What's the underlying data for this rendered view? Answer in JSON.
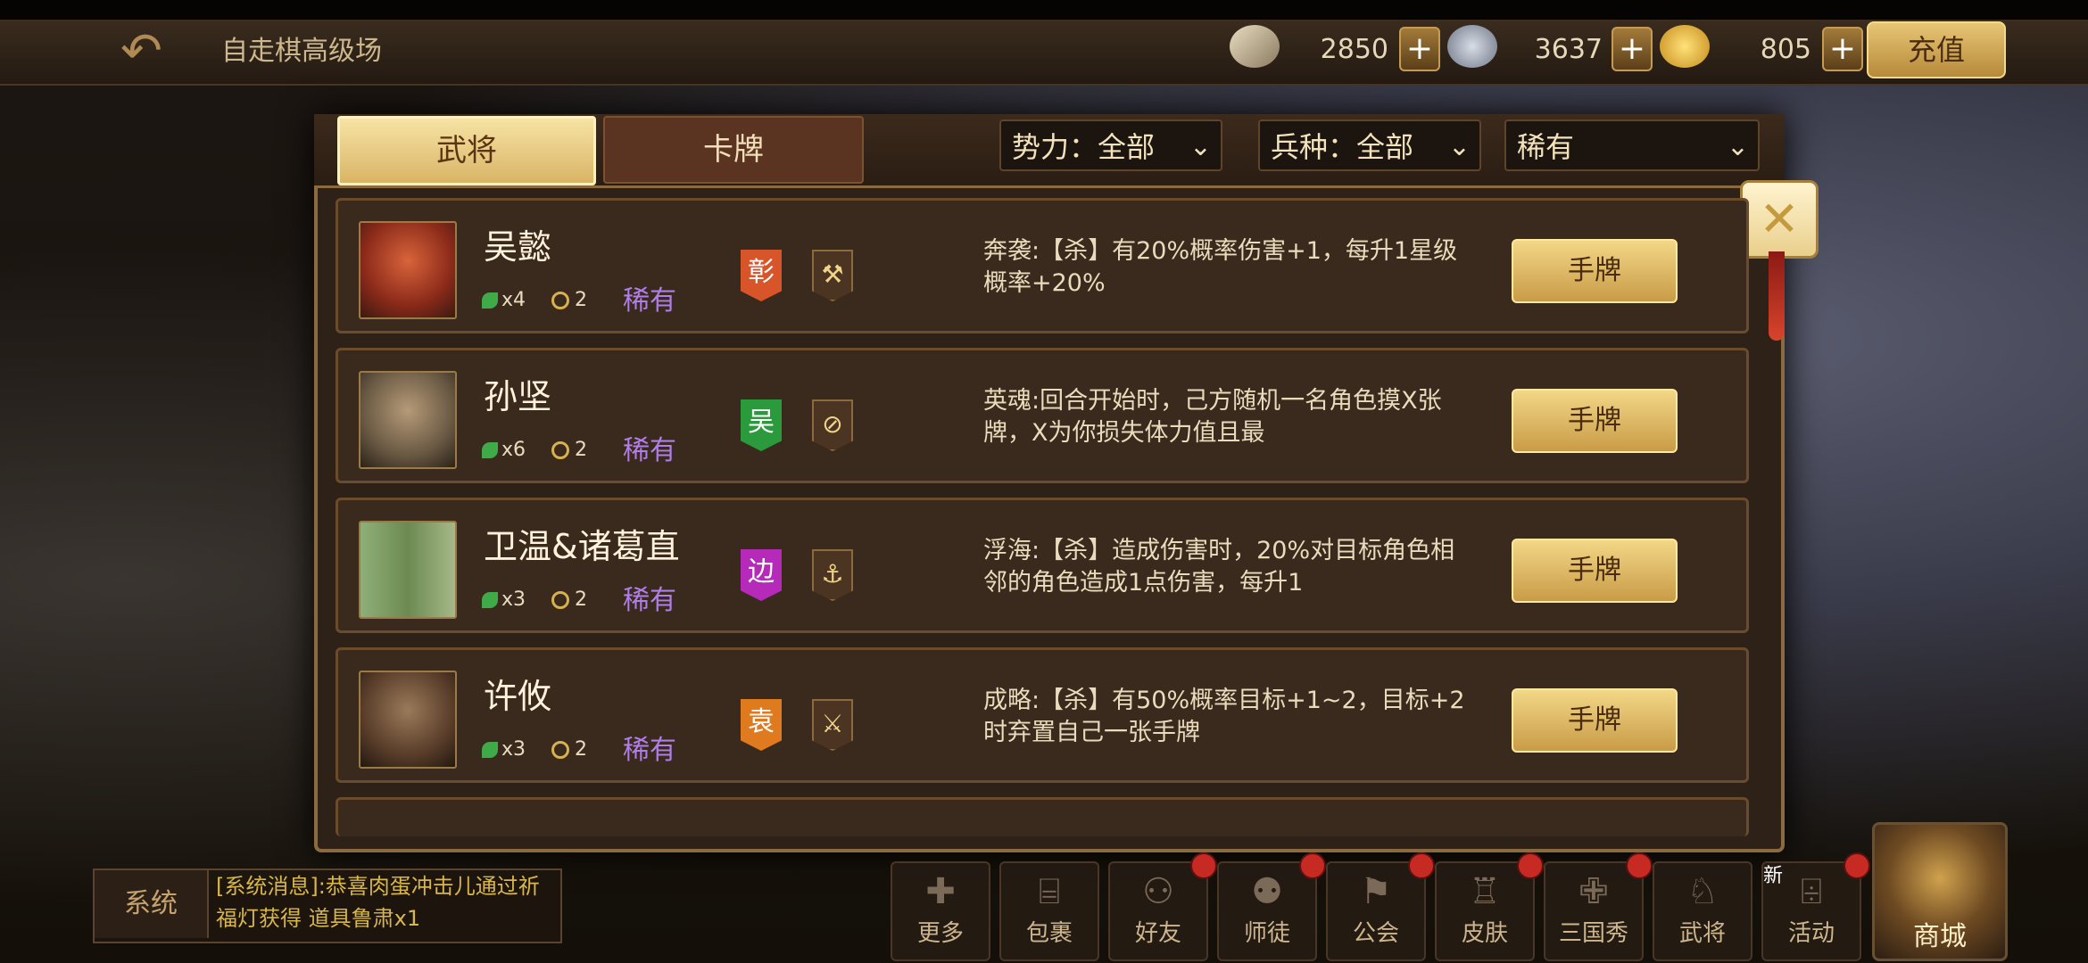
{
  "topbar": {
    "title": "自走棋高级场",
    "currencies": [
      {
        "icon": "scroll-icon",
        "value": "2850"
      },
      {
        "icon": "silver-ingot-icon",
        "value": "3637"
      },
      {
        "icon": "gold-ingot-icon",
        "value": "805"
      }
    ],
    "plus": "+",
    "recharge_label": "充值"
  },
  "panel": {
    "tabs": [
      "武将",
      "卡牌"
    ],
    "active_tab": "武将",
    "filters": {
      "faction": "势力：全部",
      "troop": "兵种：全部",
      "rarity": "稀有"
    },
    "close": "✕",
    "rows": [
      {
        "name": "吴懿",
        "stars": "x4",
        "cost": "2",
        "rarity": "稀有",
        "faction": "彰",
        "faction_color": "#d8552a",
        "unit_icon": "axe-icon",
        "unit_glyph": "⚒",
        "desc": "奔袭:【杀】有20%概率伤害+1，每升1星级概率+20%",
        "button": "手牌",
        "avatar_color": "#8b2a1a"
      },
      {
        "name": "孙坚",
        "stars": "x6",
        "cost": "2",
        "rarity": "稀有",
        "faction": "吴",
        "faction_color": "#2a9a3c",
        "unit_icon": "shield-icon",
        "unit_glyph": "⊘",
        "desc": "英魂:回合开始时，己方随机一名角色摸X张牌，X为你损失体力值且最",
        "button": "手牌",
        "avatar_color": "#6a5a44"
      },
      {
        "name": "卫温&诸葛直",
        "stars": "x3",
        "cost": "2",
        "rarity": "稀有",
        "faction": "边",
        "faction_color": "#b52ab8",
        "unit_icon": "anchor-icon",
        "unit_glyph": "⚓",
        "desc": "浮海:【杀】造成伤害时，20%对目标角色相邻的角色造成1点伤害，每升1",
        "button": "手牌",
        "avatar_color": "#6c8a52"
      },
      {
        "name": "许攸",
        "stars": "x3",
        "cost": "2",
        "rarity": "稀有",
        "faction": "袁",
        "faction_color": "#e07a1e",
        "unit_icon": "sword-icon",
        "unit_glyph": "⚔",
        "desc": "成略:【杀】有50%概率目标+1~2，目标+2时弃置自己一张手牌",
        "button": "手牌",
        "avatar_color": "#5a3e2a"
      }
    ]
  },
  "chat": {
    "tab": "系统",
    "message": "[系统消息]:恭喜肉蛋冲击儿通过祈福灯获得 道具鲁肃x1"
  },
  "nav": {
    "items": [
      {
        "label": "更多",
        "icon": "plus-icon",
        "glyph": "✚",
        "badge": false
      },
      {
        "label": "包裹",
        "icon": "bag-icon",
        "glyph": "⌸",
        "badge": false
      },
      {
        "label": "好友",
        "icon": "friends-icon",
        "glyph": "⚇",
        "badge": true
      },
      {
        "label": "师徒",
        "icon": "mentor-icon",
        "glyph": "⚉",
        "badge": true
      },
      {
        "label": "公会",
        "icon": "guild-icon",
        "glyph": "⚑",
        "badge": true
      },
      {
        "label": "皮肤",
        "icon": "shirt-icon",
        "glyph": "♖",
        "badge": true
      },
      {
        "label": "三国秀",
        "icon": "show-icon",
        "glyph": "✙",
        "badge": true
      },
      {
        "label": "武将",
        "icon": "helmet-icon",
        "glyph": "♘",
        "badge": false
      },
      {
        "label": "活动",
        "icon": "gift-icon",
        "glyph": "⌹",
        "badge": true
      }
    ],
    "new_tag": "新",
    "shop_label": "商城"
  }
}
